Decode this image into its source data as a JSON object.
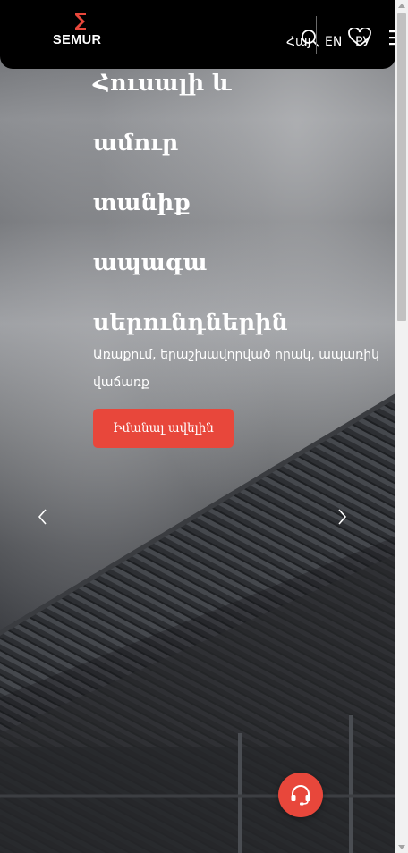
{
  "header": {
    "brand": "SEMUR",
    "lang_hy": "Հայ",
    "lang_en": "EN",
    "lang_ru": "РУ"
  },
  "hero": {
    "title_lines": [
      "Հուսալի և",
      "ամուր",
      "տանիք",
      "ապագա",
      "սերունդներին"
    ],
    "subtitle": "Առաքում, երաշխավորված որակ, ապառիկ վաճառք",
    "cta": "Իմանալ ավելին"
  },
  "colors": {
    "accent": "#e8473b",
    "header_bg": "#000000"
  },
  "icons": [
    "logo-mark",
    "search-icon",
    "heart-icon",
    "menu-icon",
    "chevron-left-icon",
    "chevron-right-icon",
    "headset-icon"
  ]
}
